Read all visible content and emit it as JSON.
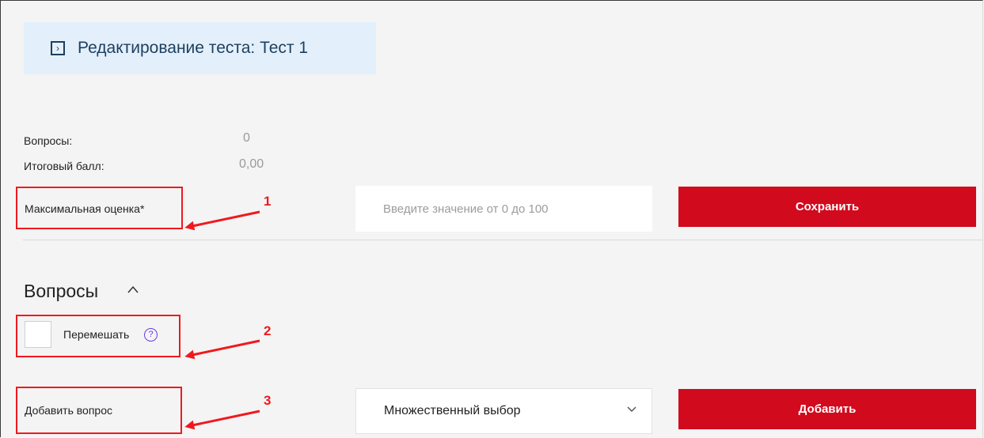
{
  "header": {
    "title": "Редактирование теста: Тест 1",
    "icon": "expand-box-icon"
  },
  "stats": {
    "questions_label": "Вопросы:",
    "questions_value": "0",
    "total_score_label": "Итоговый балл:",
    "total_score_value": "0,00"
  },
  "max_grade": {
    "label": "Максимальная оценка*",
    "placeholder": "Введите значение от 0 до 100",
    "save_label": "Сохранить"
  },
  "questions_section": {
    "title": "Вопросы",
    "shuffle_label": "Перемешать",
    "help_glyph": "?"
  },
  "add_question": {
    "label": "Добавить вопрос",
    "type_value": "Множественный выбор",
    "add_label": "Добавить"
  },
  "annotations": [
    "1",
    "2",
    "3"
  ],
  "colors": {
    "accent_red": "#d10a1e",
    "annotation_red": "#f0191e",
    "title_bg": "#e3f0fb",
    "title_text": "#1c3f5e",
    "help_purple": "#6a3be0"
  }
}
